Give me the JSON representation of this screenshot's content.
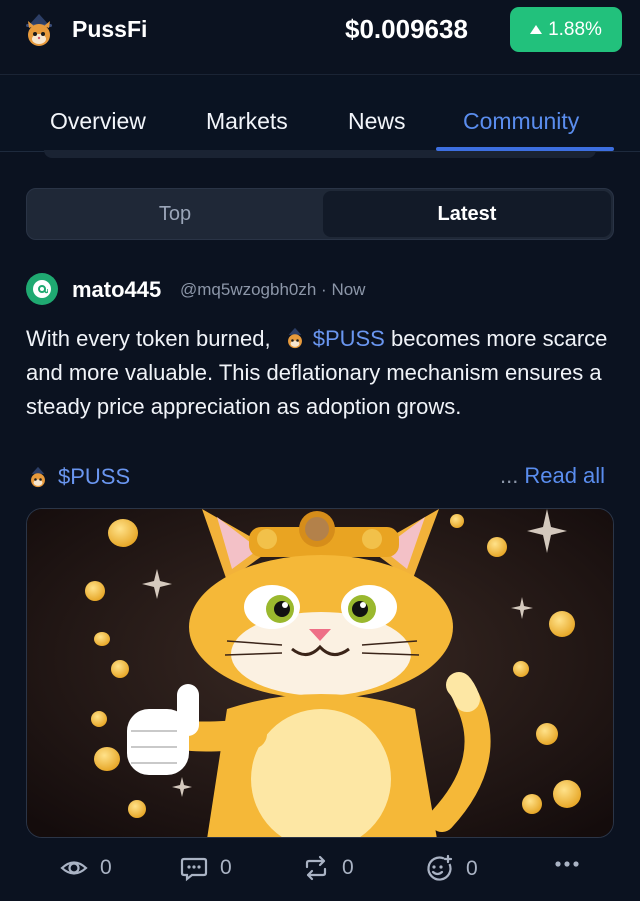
{
  "header": {
    "app_name": "PussFi",
    "price": "$0.009638",
    "change": "1.88%",
    "change_color": "#22c17c",
    "logo_icon": "cat-logo-icon"
  },
  "tabs": [
    {
      "label": "Overview",
      "active": false
    },
    {
      "label": "Markets",
      "active": false
    },
    {
      "label": "News",
      "active": false
    },
    {
      "label": "Community",
      "active": true
    }
  ],
  "segmented": {
    "top_label": "Top",
    "latest_label": "Latest",
    "selected": "Latest"
  },
  "post": {
    "username": "mato445",
    "handle": "@mq5wzogbh0zh · Now",
    "text_before": "With every token burned,",
    "cashtag": "$PUSS",
    "text_after": "becomes more scarce and more valuable. This deflationary mechanism ensures a steady price appreciation as adoption grows.",
    "tag": "$PUSS",
    "ellipsis": "...",
    "read_all": "Read all",
    "image_icon": "cat-thumbs-up-illustration"
  },
  "actions": {
    "views": "0",
    "comments": "0",
    "reposts": "0",
    "reactions": "0",
    "more_icon": "more-icon"
  },
  "colors": {
    "background": "#0b1220",
    "accent": "#5a8dee",
    "positive": "#22c17c"
  }
}
